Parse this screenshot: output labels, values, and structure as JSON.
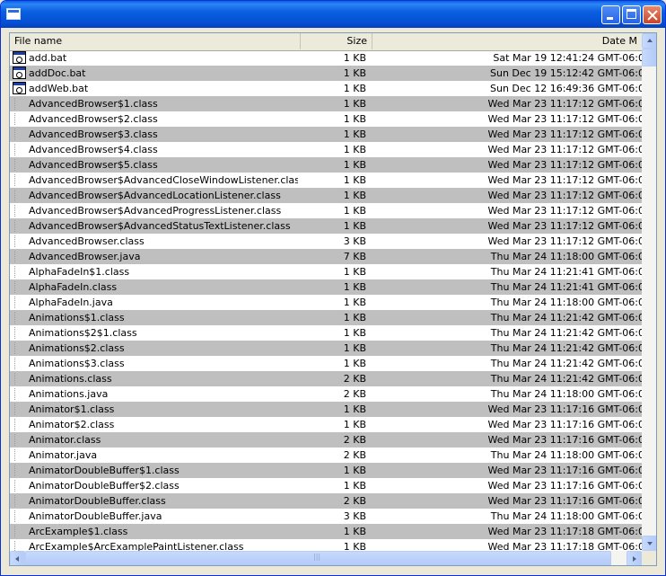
{
  "window": {
    "title": ""
  },
  "columns": {
    "name": "File name",
    "size": "Size",
    "date": "Date M"
  },
  "files": [
    {
      "name": "add.bat",
      "size": "1 KB",
      "date": "Sat Mar 19 12:41:24 GMT-06:0",
      "icon": "bat-file-icon"
    },
    {
      "name": "addDoc.bat",
      "size": "1 KB",
      "date": "Sun Dec 19 15:12:42 GMT-06:0",
      "icon": "bat-file-icon"
    },
    {
      "name": "addWeb.bat",
      "size": "1 KB",
      "date": "Sun Dec 12 16:49:36 GMT-06:0",
      "icon": "bat-file-icon"
    },
    {
      "name": "AdvancedBrowser$1.class",
      "size": "1 KB",
      "date": "Wed Mar 23 11:17:12 GMT-06:0",
      "icon": "file-icon"
    },
    {
      "name": "AdvancedBrowser$2.class",
      "size": "1 KB",
      "date": "Wed Mar 23 11:17:12 GMT-06:0",
      "icon": "file-icon"
    },
    {
      "name": "AdvancedBrowser$3.class",
      "size": "1 KB",
      "date": "Wed Mar 23 11:17:12 GMT-06:0",
      "icon": "file-icon"
    },
    {
      "name": "AdvancedBrowser$4.class",
      "size": "1 KB",
      "date": "Wed Mar 23 11:17:12 GMT-06:0",
      "icon": "file-icon"
    },
    {
      "name": "AdvancedBrowser$5.class",
      "size": "1 KB",
      "date": "Wed Mar 23 11:17:12 GMT-06:0",
      "icon": "file-icon"
    },
    {
      "name": "AdvancedBrowser$AdvancedCloseWindowListener.class",
      "size": "1 KB",
      "date": "Wed Mar 23 11:17:12 GMT-06:0",
      "icon": "file-icon"
    },
    {
      "name": "AdvancedBrowser$AdvancedLocationListener.class",
      "size": "1 KB",
      "date": "Wed Mar 23 11:17:12 GMT-06:0",
      "icon": "file-icon"
    },
    {
      "name": "AdvancedBrowser$AdvancedProgressListener.class",
      "size": "1 KB",
      "date": "Wed Mar 23 11:17:12 GMT-06:0",
      "icon": "file-icon"
    },
    {
      "name": "AdvancedBrowser$AdvancedStatusTextListener.class",
      "size": "1 KB",
      "date": "Wed Mar 23 11:17:12 GMT-06:0",
      "icon": "file-icon"
    },
    {
      "name": "AdvancedBrowser.class",
      "size": "3 KB",
      "date": "Wed Mar 23 11:17:12 GMT-06:0",
      "icon": "file-icon"
    },
    {
      "name": "AdvancedBrowser.java",
      "size": "7 KB",
      "date": "Thu Mar 24 11:18:00 GMT-06:0",
      "icon": "file-icon"
    },
    {
      "name": "AlphaFadeIn$1.class",
      "size": "1 KB",
      "date": "Thu Mar 24 11:21:41 GMT-06:0",
      "icon": "file-icon"
    },
    {
      "name": "AlphaFadeIn.class",
      "size": "1 KB",
      "date": "Thu Mar 24 11:21:41 GMT-06:0",
      "icon": "file-icon"
    },
    {
      "name": "AlphaFadeIn.java",
      "size": "1 KB",
      "date": "Thu Mar 24 11:18:00 GMT-06:0",
      "icon": "file-icon"
    },
    {
      "name": "Animations$1.class",
      "size": "1 KB",
      "date": "Thu Mar 24 11:21:42 GMT-06:0",
      "icon": "file-icon"
    },
    {
      "name": "Animations$2$1.class",
      "size": "1 KB",
      "date": "Thu Mar 24 11:21:42 GMT-06:0",
      "icon": "file-icon"
    },
    {
      "name": "Animations$2.class",
      "size": "1 KB",
      "date": "Thu Mar 24 11:21:42 GMT-06:0",
      "icon": "file-icon"
    },
    {
      "name": "Animations$3.class",
      "size": "1 KB",
      "date": "Thu Mar 24 11:21:42 GMT-06:0",
      "icon": "file-icon"
    },
    {
      "name": "Animations.class",
      "size": "2 KB",
      "date": "Thu Mar 24 11:21:42 GMT-06:0",
      "icon": "file-icon"
    },
    {
      "name": "Animations.java",
      "size": "2 KB",
      "date": "Thu Mar 24 11:18:00 GMT-06:0",
      "icon": "file-icon"
    },
    {
      "name": "Animator$1.class",
      "size": "1 KB",
      "date": "Wed Mar 23 11:17:16 GMT-06:0",
      "icon": "file-icon"
    },
    {
      "name": "Animator$2.class",
      "size": "1 KB",
      "date": "Wed Mar 23 11:17:16 GMT-06:0",
      "icon": "file-icon"
    },
    {
      "name": "Animator.class",
      "size": "2 KB",
      "date": "Wed Mar 23 11:17:16 GMT-06:0",
      "icon": "file-icon"
    },
    {
      "name": "Animator.java",
      "size": "2 KB",
      "date": "Thu Mar 24 11:18:00 GMT-06:0",
      "icon": "file-icon"
    },
    {
      "name": "AnimatorDoubleBuffer$1.class",
      "size": "1 KB",
      "date": "Wed Mar 23 11:17:16 GMT-06:0",
      "icon": "file-icon"
    },
    {
      "name": "AnimatorDoubleBuffer$2.class",
      "size": "1 KB",
      "date": "Wed Mar 23 11:17:16 GMT-06:0",
      "icon": "file-icon"
    },
    {
      "name": "AnimatorDoubleBuffer.class",
      "size": "2 KB",
      "date": "Wed Mar 23 11:17:16 GMT-06:0",
      "icon": "file-icon"
    },
    {
      "name": "AnimatorDoubleBuffer.java",
      "size": "3 KB",
      "date": "Thu Mar 24 11:18:00 GMT-06:0",
      "icon": "file-icon"
    },
    {
      "name": "ArcExample$1.class",
      "size": "1 KB",
      "date": "Wed Mar 23 11:17:18 GMT-06:0",
      "icon": "file-icon"
    },
    {
      "name": "ArcExample$ArcExamplePaintListener.class",
      "size": "1 KB",
      "date": "Wed Mar 23 11:17:18 GMT-06:0",
      "icon": "file-icon"
    }
  ],
  "colors": {
    "row_alt": "#bfbfbf",
    "title_bar": "#0a5fe0"
  }
}
